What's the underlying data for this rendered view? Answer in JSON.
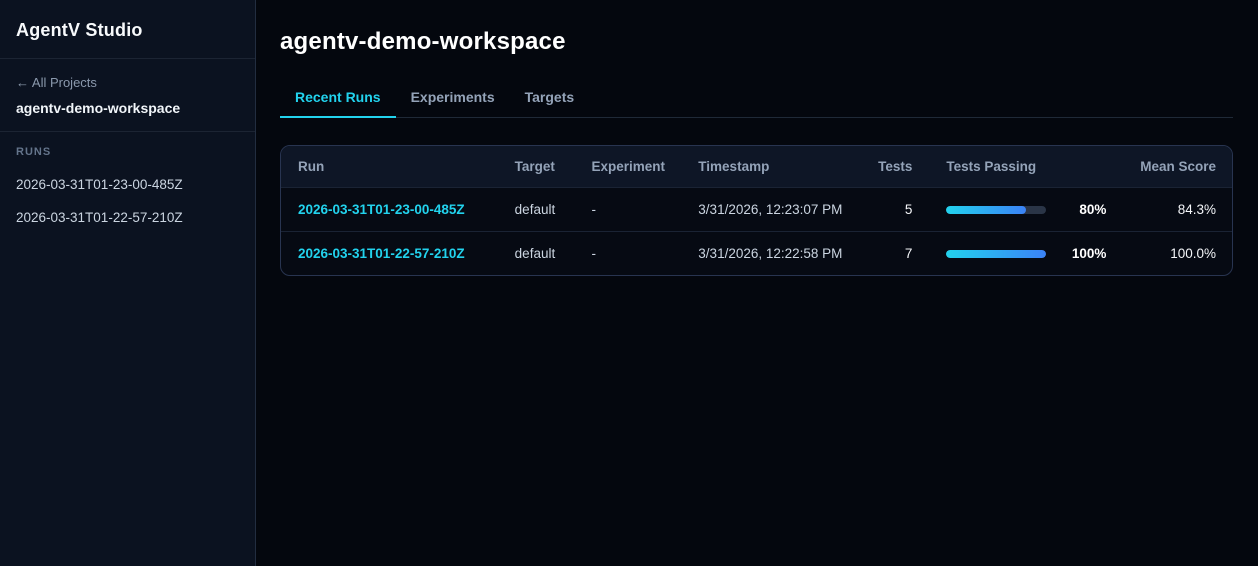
{
  "app": {
    "title": "AgentV Studio"
  },
  "sidebar": {
    "back_link": "← All Projects",
    "workspace_name": "agentv-demo-workspace",
    "runs_header": "RUNS",
    "runs": [
      "2026-03-31T01-23-00-485Z",
      "2026-03-31T01-22-57-210Z"
    ]
  },
  "main": {
    "title": "agentv-demo-workspace",
    "tabs": [
      {
        "label": "Recent Runs",
        "active": true
      },
      {
        "label": "Experiments",
        "active": false
      },
      {
        "label": "Targets",
        "active": false
      }
    ],
    "table": {
      "columns": [
        "Run",
        "Target",
        "Experiment",
        "Timestamp",
        "Tests",
        "Tests Passing",
        "Mean Score"
      ],
      "rows": [
        {
          "run": "2026-03-31T01-23-00-485Z",
          "target": "default",
          "experiment": "-",
          "timestamp": "3/31/2026, 12:23:07 PM",
          "tests": "5",
          "passing_value": 80,
          "passing_pct": "80%",
          "mean_score": "84.3%"
        },
        {
          "run": "2026-03-31T01-22-57-210Z",
          "target": "default",
          "experiment": "-",
          "timestamp": "3/31/2026, 12:22:58 PM",
          "tests": "7",
          "passing_value": 100,
          "passing_pct": "100%",
          "mean_score": "100.0%"
        }
      ]
    }
  },
  "colors": {
    "accent_cyan": "#22d3ee",
    "accent_blue": "#3b82f6",
    "sidebar_bg": "#0b1220",
    "main_bg": "#04070e",
    "card_header_bg": "#0e1626",
    "border": "#283450"
  }
}
